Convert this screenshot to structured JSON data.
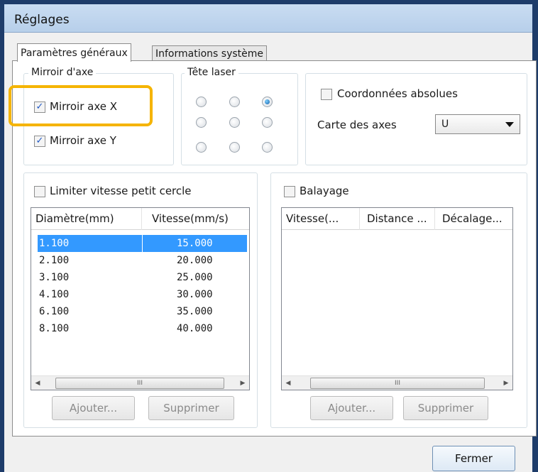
{
  "window": {
    "title": "Réglages"
  },
  "tabs": [
    {
      "label": "Paramètres généraux",
      "active": true
    },
    {
      "label": "Informations système",
      "active": false
    }
  ],
  "mirror_group": {
    "legend": "Mirroir d'axe",
    "mirror_x": {
      "label": "Mirroir axe X",
      "checked": true
    },
    "mirror_y": {
      "label": "Mirroir axe Y",
      "checked": true
    }
  },
  "laser_head": {
    "legend": "Tête laser",
    "selected": {
      "row": 0,
      "col": 2
    }
  },
  "coordinates": {
    "absolute_label": "Coordonnées absolues",
    "absolute_checked": false,
    "axis_map_label": "Carte des axes",
    "axis_map_value": "U"
  },
  "circle_speed": {
    "checkbox_label": "Limiter vitesse petit cercle",
    "checked": false,
    "columns": [
      "Diamètre(mm)",
      "Vitesse(mm/s)"
    ],
    "rows": [
      [
        "1.100",
        "15.000"
      ],
      [
        "2.100",
        "20.000"
      ],
      [
        "3.100",
        "25.000"
      ],
      [
        "4.100",
        "30.000"
      ],
      [
        "6.100",
        "35.000"
      ],
      [
        "8.100",
        "40.000"
      ]
    ],
    "selected_row": 0,
    "add_label": "Ajouter...",
    "delete_label": "Supprimer"
  },
  "sweep": {
    "checkbox_label": "Balayage",
    "checked": false,
    "columns": [
      "Vitesse(...",
      "Distance ...",
      "Décalage..."
    ],
    "add_label": "Ajouter...",
    "delete_label": "Supprimer"
  },
  "scrollbar_thumb_glyph": "III",
  "close_label": "Fermer",
  "colors": {
    "highlight": "#f5b400",
    "selection": "#3399ff",
    "titlebar": "#b7cfea"
  }
}
